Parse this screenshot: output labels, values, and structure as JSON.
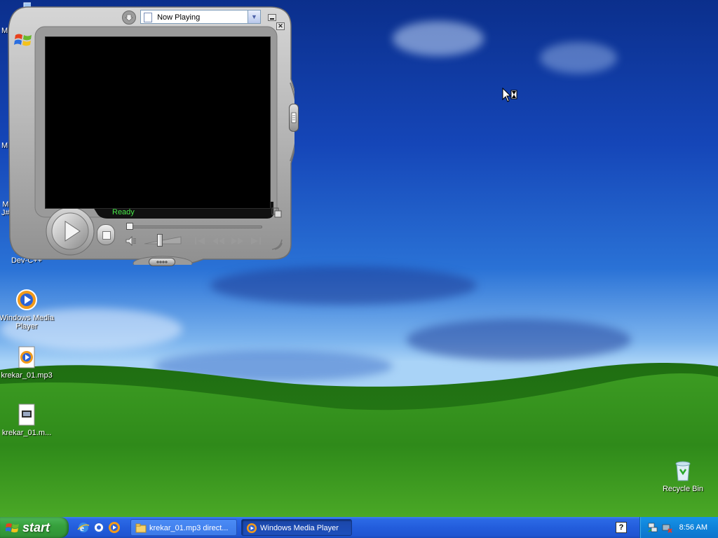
{
  "desktop": {
    "icons": [
      {
        "label": "M",
        "icon": "computer-icon"
      },
      {
        "label": "M",
        "icon": "documents-icon"
      },
      {
        "label": "M\nJ#",
        "icon": "java-icon"
      },
      {
        "label": "Dev-C++",
        "icon": "devcpp-icon"
      },
      {
        "label": "Windows Media\nPlayer",
        "icon": "media-player-icon"
      },
      {
        "label": "krekar_01.mp3",
        "icon": "mp3-file-icon"
      },
      {
        "label": "krekar_01.m...",
        "icon": "media-file-icon"
      },
      {
        "label": "Recycle Bin",
        "icon": "recycle-bin-icon"
      }
    ]
  },
  "media_player": {
    "playlist_select": "Now Playing",
    "status": "Ready",
    "colors": {
      "status_text": "#48e848",
      "screen": "#000000",
      "shell": "#b4b4b4"
    }
  },
  "taskbar": {
    "start_label": "start",
    "quick_launch": [
      "ie-icon",
      "outlook-icon",
      "media-player-icon"
    ],
    "tasks": [
      {
        "label": "krekar_01.mp3 direct...",
        "icon": "folder-icon",
        "active": false
      },
      {
        "label": "Windows Media Player",
        "icon": "media-player-icon",
        "active": true
      }
    ],
    "help_icon": "help-icon",
    "tray_icons": [
      "network-icon",
      "safely-remove-icon"
    ],
    "clock": "8:56 AM"
  },
  "cursor": "busy-arrow-icon"
}
